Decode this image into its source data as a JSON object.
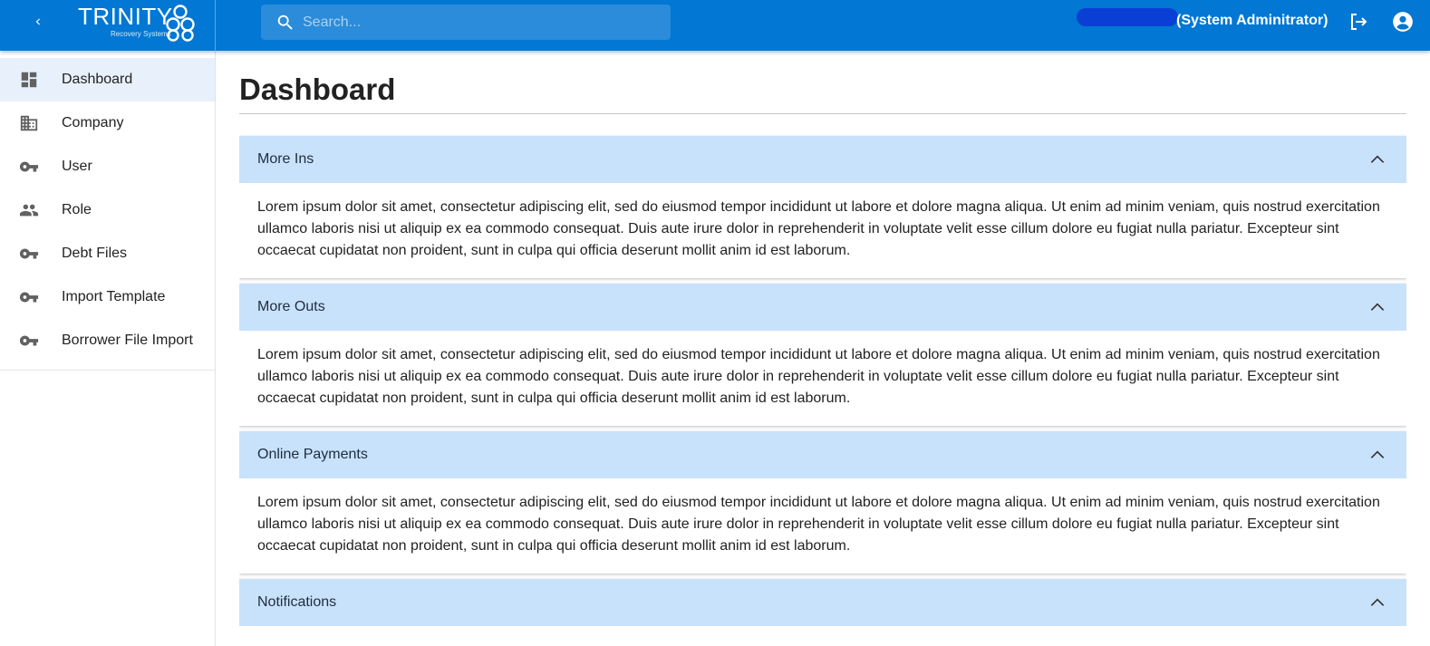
{
  "appbar": {
    "logo_title": "TRINITY",
    "logo_subtitle": "Recovery Systems",
    "search_placeholder": "Search...",
    "user_role": "(System Adminitrator)",
    "brand_color": "#0277d3"
  },
  "sidebar": {
    "items": [
      {
        "label": "Dashboard",
        "icon": "dashboard-icon",
        "active": true
      },
      {
        "label": "Company",
        "icon": "building-icon",
        "active": false
      },
      {
        "label": "User",
        "icon": "key-icon",
        "active": false
      },
      {
        "label": "Role",
        "icon": "people-icon",
        "active": false
      },
      {
        "label": "Debt Files",
        "icon": "key-icon",
        "active": false
      },
      {
        "label": "Import Template",
        "icon": "key-icon",
        "active": false
      },
      {
        "label": "Borrower File Import",
        "icon": "key-icon",
        "active": false
      }
    ]
  },
  "main": {
    "title": "Dashboard",
    "panels": [
      {
        "title": "More Ins",
        "body": "Lorem ipsum dolor sit amet, consectetur adipiscing elit, sed do eiusmod tempor incididunt ut labore et dolore magna aliqua. Ut enim ad minim veniam, quis nostrud exercitation ullamco laboris nisi ut aliquip ex ea commodo consequat. Duis aute irure dolor in reprehenderit in voluptate velit esse cillum dolore eu fugiat nulla pariatur. Excepteur sint occaecat cupidatat non proident, sunt in culpa qui officia deserunt mollit anim id est laborum."
      },
      {
        "title": "More Outs",
        "body": "Lorem ipsum dolor sit amet, consectetur adipiscing elit, sed do eiusmod tempor incididunt ut labore et dolore magna aliqua. Ut enim ad minim veniam, quis nostrud exercitation ullamco laboris nisi ut aliquip ex ea commodo consequat. Duis aute irure dolor in reprehenderit in voluptate velit esse cillum dolore eu fugiat nulla pariatur. Excepteur sint occaecat cupidatat non proident, sunt in culpa qui officia deserunt mollit anim id est laborum."
      },
      {
        "title": "Online Payments",
        "body": "Lorem ipsum dolor sit amet, consectetur adipiscing elit, sed do eiusmod tempor incididunt ut labore et dolore magna aliqua. Ut enim ad minim veniam, quis nostrud exercitation ullamco laboris nisi ut aliquip ex ea commodo consequat. Duis aute irure dolor in reprehenderit in voluptate velit esse cillum dolore eu fugiat nulla pariatur. Excepteur sint occaecat cupidatat non proident, sunt in culpa qui officia deserunt mollit anim id est laborum."
      },
      {
        "title": "Notifications",
        "body": ""
      }
    ]
  }
}
